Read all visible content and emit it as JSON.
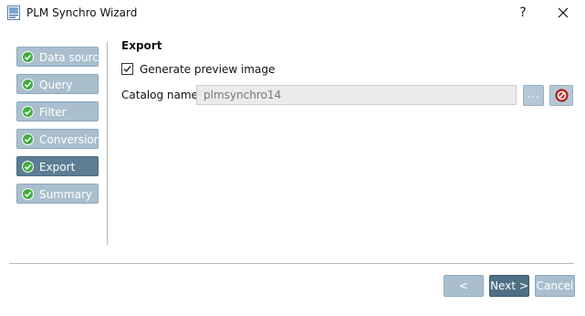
{
  "window": {
    "title": "PLM Synchro Wizard",
    "help_label": "?"
  },
  "steps": [
    {
      "label": "Data source",
      "active": false,
      "icon": "check-circle-icon"
    },
    {
      "label": "Query",
      "active": false,
      "icon": "check-circle-icon"
    },
    {
      "label": "Filter",
      "active": false,
      "icon": "check-circle-icon"
    },
    {
      "label": "Conversion",
      "active": false,
      "icon": "check-circle-icon"
    },
    {
      "label": "Export",
      "active": true,
      "icon": "check-circle-icon"
    },
    {
      "label": "Summary",
      "active": false,
      "icon": "check-circle-icon"
    }
  ],
  "export": {
    "section_title": "Export",
    "preview_checkbox": {
      "label": "Generate preview image",
      "checked": true
    },
    "catalog": {
      "label": "Catalog name:",
      "value": "plmsynchro14",
      "browse_label": "...",
      "clear_icon": "no-entry-icon"
    }
  },
  "footer": {
    "back_label": "< Back",
    "next_label": "Next >",
    "cancel_label": "Cancel"
  },
  "colors": {
    "step_inactive": "#a9bfce",
    "step_active": "#5d7d94",
    "check_green": "#3fae3f",
    "clear_red": "#d62020",
    "primary_button": "#4f6f86"
  }
}
